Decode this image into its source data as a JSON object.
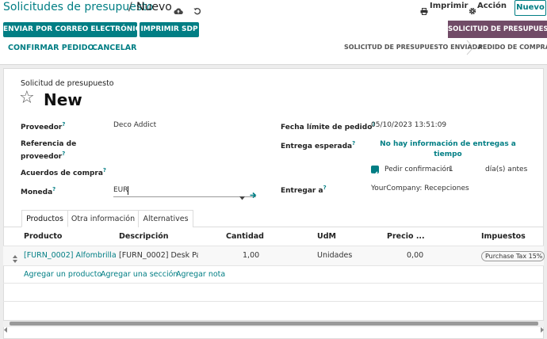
{
  "breadcrumb": {
    "parent": "Solicitudes de presupuesto",
    "separator": "/",
    "current": "Nuevo"
  },
  "toolbar": {
    "print_label": "Imprimir",
    "action_label": "Acción",
    "new_label": "Nuevo"
  },
  "actions": {
    "send_email": "ENVIAR POR CORREO ELECTRÓNICO",
    "print_rfq": "IMPRIMIR SDP",
    "confirm": "CONFIRMAR PEDIDO",
    "cancel": "CANCELAR"
  },
  "statusbar": {
    "states": [
      "SOLICITUD DE PRESUPUESTO",
      "SOLICITUD DE PRESUPUESTO ENVIADA",
      "PEDIDO DE COMPRA"
    ],
    "active": "SOLICITUD DE PRESUPUESTO"
  },
  "form": {
    "subtitle": "Solicitud de presupuesto",
    "title": "New",
    "left": {
      "vendor_label": "Proveedor",
      "vendor_value": "Deco Addict",
      "ref_label_1": "Referencia de",
      "ref_label_2": "proveedor",
      "agreement_label": "Acuerdos de compra",
      "currency_label": "Moneda",
      "currency_value": "EUR"
    },
    "right": {
      "deadline_label": "Fecha límite de pedido",
      "deadline_value": "05/10/2023 13:51:09",
      "expected_label": "Entrega esperada",
      "expected_value_1": "No hay información de entregas a",
      "expected_value_2": "tiempo",
      "ask_confirm_label": "Pedir confirmación",
      "ask_confirm_value": "1",
      "ask_confirm_unit": "día(s) antes",
      "deliver_label": "Entregar a",
      "deliver_value": "YourCompany: Recepciones"
    },
    "help_mark": "?"
  },
  "tabs": [
    "Productos",
    "Otra información",
    "Alternatives"
  ],
  "table": {
    "headers": [
      "Producto",
      "Descripción",
      "Cantidad",
      "UdM",
      "Precio ...",
      "Impuestos"
    ],
    "rows": [
      {
        "product": "[FURN_0002] Alfombrilla de",
        "description": "[FURN_0002] Desk Pad",
        "qty": "1,00",
        "uom": "Unidades",
        "price": "0,00",
        "tax": "Purchase Tax 15%"
      }
    ],
    "add_links": [
      "Agregar un producto",
      "Agregar una sección",
      "Agregar nota"
    ]
  },
  "colors": {
    "primary": "#017e84",
    "state_active": "#714b67"
  }
}
